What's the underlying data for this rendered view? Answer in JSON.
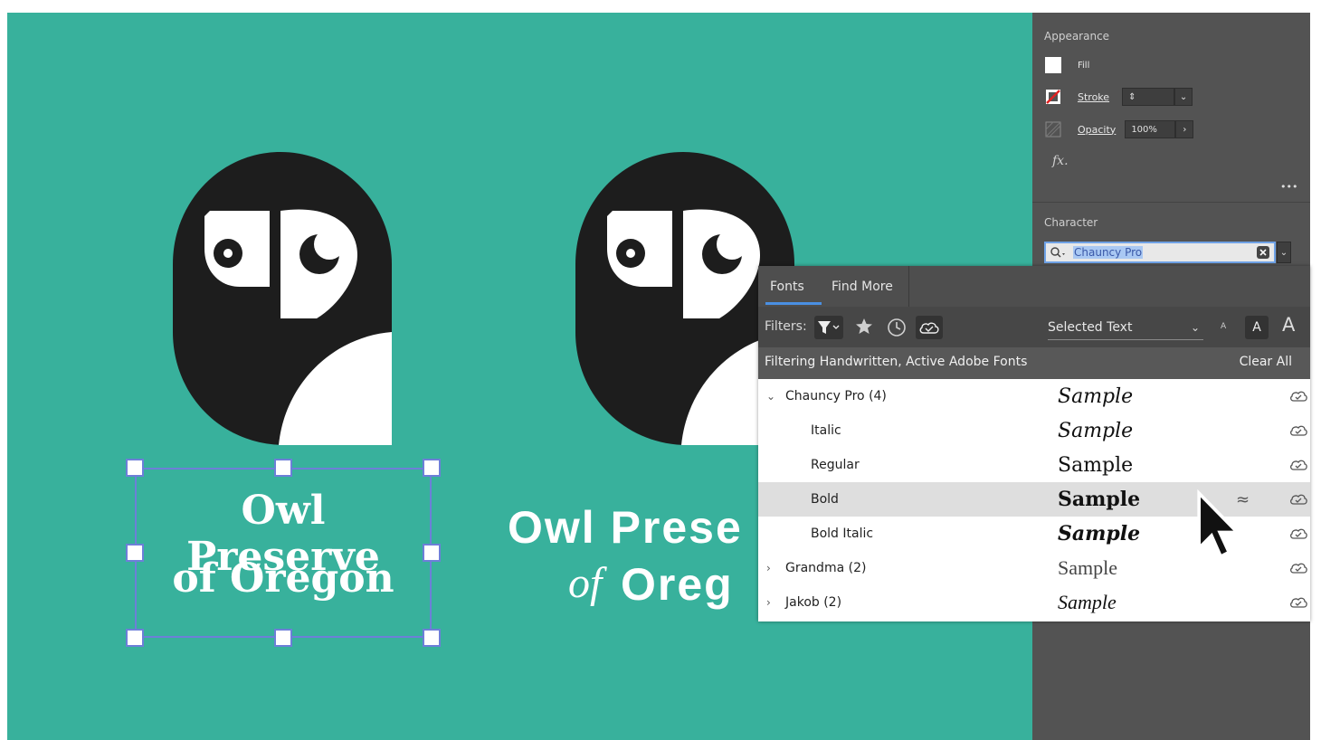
{
  "canvas": {
    "background": "#38b19c",
    "logo_left": {
      "line1": "Owl Preserve",
      "line2": "of Oregon"
    },
    "logo_right": {
      "line1": "Owl Prese",
      "line2_of": "of",
      "line2": "Oreg"
    }
  },
  "properties": {
    "appearance_title": "Appearance",
    "fill_label": "Fill",
    "stroke_label": "Stroke",
    "opacity_label": "Opacity",
    "opacity_value": "100%",
    "fx_label": "fx.",
    "more_label": "•••",
    "character_title": "Character",
    "font_search_value": "Chauncy Pro"
  },
  "font_popover": {
    "tabs": [
      "Fonts",
      "Find More"
    ],
    "active_tab": "Fonts",
    "filters_label": "Filters:",
    "preview_select": "Selected Text",
    "size_small": "A",
    "size_medium": "A",
    "size_large": "A",
    "status": "Filtering Handwritten, Active Adobe Fonts",
    "clear_all": "Clear All",
    "fonts": [
      {
        "name": "Chauncy Pro (4)",
        "sample": "Sample",
        "expanded": true,
        "level": 0
      },
      {
        "name": "Italic",
        "sample": "Sample",
        "level": 1
      },
      {
        "name": "Regular",
        "sample": "Sample",
        "level": 1
      },
      {
        "name": "Bold",
        "sample": "Sample",
        "level": 1,
        "hovered": true,
        "similar_icon": "≈"
      },
      {
        "name": "Bold Italic",
        "sample": "Sample",
        "level": 1
      },
      {
        "name": "Grandma (2)",
        "sample": "Sample",
        "expanded": false,
        "level": 0
      },
      {
        "name": "Jakob (2)",
        "sample": "Sample",
        "expanded": false,
        "level": 0
      }
    ]
  },
  "colors": {
    "accent": "#4a8fe2",
    "selection": "#6d7fd8",
    "panel": "#535353"
  }
}
